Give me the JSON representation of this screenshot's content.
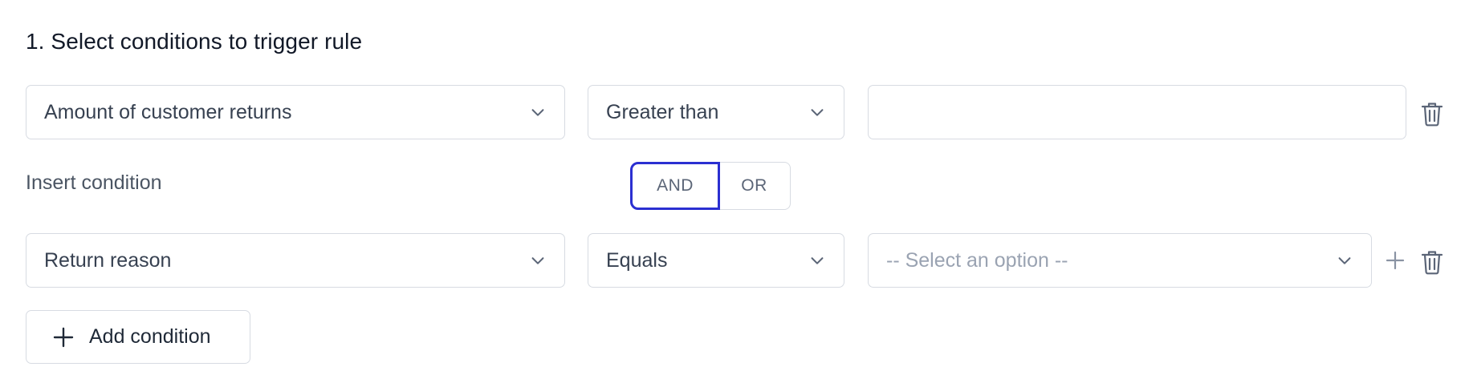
{
  "section": {
    "title": "1. Select conditions to trigger rule"
  },
  "condition1": {
    "field": "Amount of customer returns",
    "operator": "Greater than",
    "value": ""
  },
  "connector": {
    "insert_label": "Insert condition",
    "and_label": "AND",
    "or_label": "OR",
    "selected": "AND"
  },
  "condition2": {
    "field": "Return reason",
    "operator": "Equals",
    "value_placeholder": "-- Select an option --"
  },
  "actions": {
    "add_condition_label": "Add condition"
  },
  "colors": {
    "accent": "#2b2fd1",
    "border": "#d7dbe2",
    "icon": "#5b6577"
  }
}
